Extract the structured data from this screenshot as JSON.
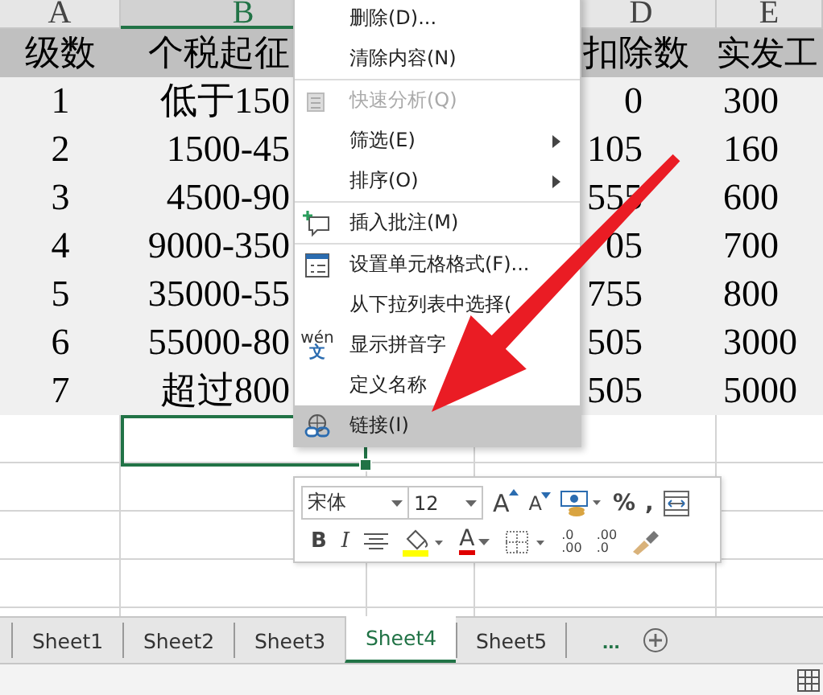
{
  "columns": [
    {
      "letter": "A",
      "selected": false
    },
    {
      "letter": "B",
      "selected": true
    },
    {
      "letter": "D",
      "selected": false
    },
    {
      "letter": "E",
      "selected": false
    }
  ],
  "header": [
    "级数",
    "个税起征",
    "扣除数",
    "实发工"
  ],
  "rows": [
    [
      "1",
      "低于150",
      "0",
      "300"
    ],
    [
      "2",
      "1500-45",
      "105",
      "160"
    ],
    [
      "3",
      "4500-90",
      "555",
      "600"
    ],
    [
      "4",
      "9000-350",
      "05",
      "700"
    ],
    [
      "5",
      "35000-55",
      "755",
      "800"
    ],
    [
      "6",
      "55000-80",
      "505",
      "3000"
    ],
    [
      "7",
      "超过800",
      "505",
      "5000"
    ]
  ],
  "context_menu": [
    {
      "label": "删除(D)...",
      "disabled": false,
      "submenu": false,
      "selected": false,
      "separator_after": false
    },
    {
      "label": "清除内容(N)",
      "disabled": false,
      "submenu": false,
      "selected": false,
      "separator_after": true
    },
    {
      "label": "快速分析(Q)",
      "disabled": true,
      "submenu": false,
      "selected": false,
      "separator_after": false
    },
    {
      "label": "筛选(E)",
      "disabled": false,
      "submenu": true,
      "selected": false,
      "separator_after": false
    },
    {
      "label": "排序(O)",
      "disabled": false,
      "submenu": true,
      "selected": false,
      "separator_after": true
    },
    {
      "label": "插入批注(M)",
      "disabled": false,
      "submenu": false,
      "selected": false,
      "separator_after": true
    },
    {
      "label": "设置单元格格式(F)...",
      "disabled": false,
      "submenu": false,
      "selected": false,
      "separator_after": false
    },
    {
      "label": "从下拉列表中选择(",
      "disabled": false,
      "submenu": false,
      "selected": false,
      "separator_after": false
    },
    {
      "label": "显示拼音字",
      "icon_texts": [
        "wén",
        "文"
      ],
      "disabled": false,
      "submenu": false,
      "selected": false,
      "separator_after": false
    },
    {
      "label": "定义名称",
      "disabled": false,
      "submenu": false,
      "selected": false,
      "separator_after": false
    },
    {
      "label": "链接(I)",
      "disabled": false,
      "submenu": false,
      "selected": true,
      "separator_after": false
    }
  ],
  "mini_toolbar": {
    "font": "宋体",
    "size": "12",
    "row1": [
      {
        "kind": "letter",
        "text": "A"
      },
      {
        "kind": "letter",
        "text": "A"
      },
      {
        "kind": "currency"
      },
      {
        "kind": "text",
        "text": "%"
      },
      {
        "kind": "text",
        "text": ","
      },
      {
        "kind": "table"
      }
    ],
    "row2": [
      {
        "kind": "bold",
        "text": "B"
      },
      {
        "kind": "italic",
        "text": "I"
      },
      {
        "kind": "align"
      },
      {
        "kind": "fill"
      },
      {
        "kind": "fontcolor",
        "text": "A"
      },
      {
        "kind": "border"
      },
      {
        "kind": "decimal",
        "text": ".0",
        "text2": ".00"
      },
      {
        "kind": "decimal",
        "text": ".00",
        "text2": ".0"
      },
      {
        "kind": "painter"
      }
    ]
  },
  "sheet_tabs": [
    {
      "label": "Sheet1",
      "selected": false
    },
    {
      "label": "Sheet2",
      "selected": false
    },
    {
      "label": "Sheet3",
      "selected": false
    },
    {
      "label": "Sheet4",
      "selected": true
    },
    {
      "label": "Sheet5",
      "selected": false
    }
  ],
  "more_tabs": "..."
}
